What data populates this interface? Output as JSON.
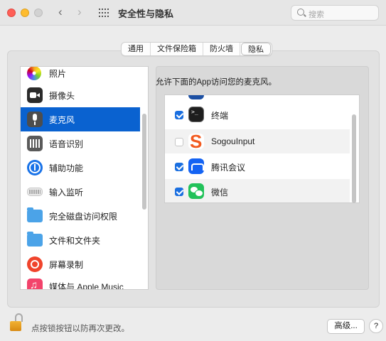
{
  "window": {
    "title": "安全性与隐私",
    "search_placeholder": "搜索"
  },
  "tabs": [
    {
      "label": "通用",
      "active": false
    },
    {
      "label": "文件保险箱",
      "active": false
    },
    {
      "label": "防火墙",
      "active": false
    },
    {
      "label": "隐私",
      "active": true
    }
  ],
  "sidebar": {
    "items": [
      {
        "label": "照片",
        "icon": "photos-icon"
      },
      {
        "label": "摄像头",
        "icon": "camera-icon"
      },
      {
        "label": "麦克风",
        "icon": "microphone-icon",
        "selected": true
      },
      {
        "label": "语音识别",
        "icon": "speech-recognition-icon"
      },
      {
        "label": "辅助功能",
        "icon": "accessibility-icon"
      },
      {
        "label": "输入监听",
        "icon": "keyboard-icon"
      },
      {
        "label": "完全磁盘访问权限",
        "icon": "folder-icon"
      },
      {
        "label": "文件和文件夹",
        "icon": "folder-icon"
      },
      {
        "label": "屏幕录制",
        "icon": "screen-recording-icon"
      },
      {
        "label": "媒体与 Apple Music",
        "icon": "music-icon"
      }
    ]
  },
  "main": {
    "description": "允许下面的App访问您的麦克风。",
    "apps": [
      {
        "label": "终端",
        "checked": true,
        "icon": "terminal-icon"
      },
      {
        "label": "SogouInput",
        "checked": false,
        "icon": "sogou-icon"
      },
      {
        "label": "腾讯会议",
        "checked": true,
        "icon": "tencent-meeting-icon"
      },
      {
        "label": "微信",
        "checked": true,
        "icon": "wechat-icon"
      }
    ]
  },
  "footer": {
    "lock_message": "点按锁按钮以防再次更改。",
    "advanced_label": "高级...",
    "help_label": "?"
  },
  "colors": {
    "accent": "#0a62d0",
    "checkbox": "#1a6fe0"
  }
}
